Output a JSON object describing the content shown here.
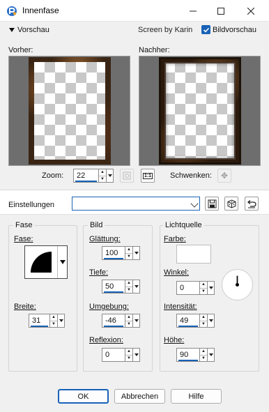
{
  "window": {
    "title": "Innenfase"
  },
  "preview_bar": {
    "toggle_label": "Vorschau",
    "screen_by": "Screen by Karin",
    "checkbox_label": "Bildvorschau",
    "checkbox_checked": true
  },
  "previews": {
    "before_label": "Vorher:",
    "after_label": "Nachher:"
  },
  "zoom": {
    "label": "Zoom:",
    "value": "22",
    "pan_label": "Schwenken:"
  },
  "settings": {
    "label": "Einstellungen",
    "value": ""
  },
  "fase_group": {
    "title": "Fase",
    "fase_label": "Fase:",
    "breite_label": "Breite:",
    "breite_value": "31"
  },
  "bild_group": {
    "title": "Bild",
    "glaettung_label": "Glättung:",
    "glaettung_value": "100",
    "tiefe_label": "Tiefe:",
    "tiefe_value": "50",
    "umgebung_label": "Umgebung:",
    "umgebung_value": "-46",
    "reflexion_label": "Reflexion:",
    "reflexion_value": "0"
  },
  "licht_group": {
    "title": "Lichtquelle",
    "farbe_label": "Farbe:",
    "farbe_color": "#ffffff",
    "winkel_label": "Winkel:",
    "winkel_value": "0",
    "intensitaet_label": "Intensität:",
    "intensitaet_value": "49",
    "hoehe_label": "Höhe:",
    "hoehe_value": "90"
  },
  "buttons": {
    "ok": "OK",
    "cancel": "Abbrechen",
    "help": "Hilfe"
  },
  "colors": {
    "accent": "#1862b7"
  }
}
